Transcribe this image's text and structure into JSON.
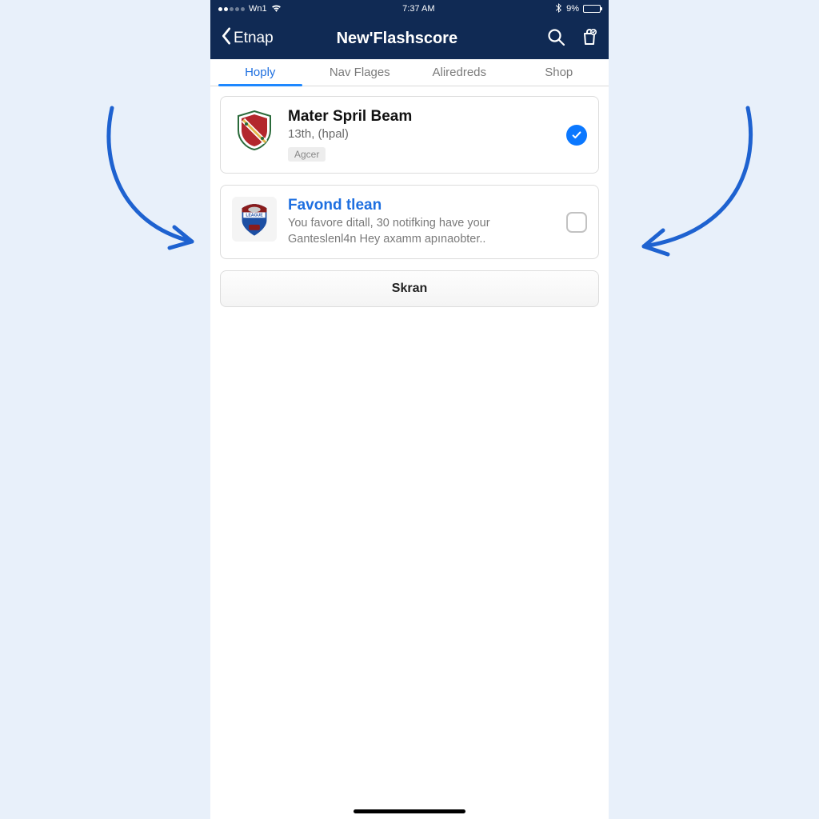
{
  "status_bar": {
    "carrier": "Wn1",
    "time": "7:37 AM",
    "battery_text": "9%"
  },
  "nav": {
    "back_label": "Etnap",
    "title": "New'Flashscore"
  },
  "tabs": [
    {
      "label": "Hoply",
      "active": true
    },
    {
      "label": "Nav Flages",
      "active": false
    },
    {
      "label": "Aliredreds",
      "active": false
    },
    {
      "label": "Shop",
      "active": false
    }
  ],
  "cards": [
    {
      "title": "Mater Spril Beam",
      "subtitle": "13th, (hpal)",
      "chip": "Agcer",
      "selected": true
    },
    {
      "title": "Favond tlean",
      "description": "You favore ditall, 30 notifking have your Ganteslenl4n Hey axamm apınaobter..",
      "selected": false
    }
  ],
  "action_button": "Skran"
}
